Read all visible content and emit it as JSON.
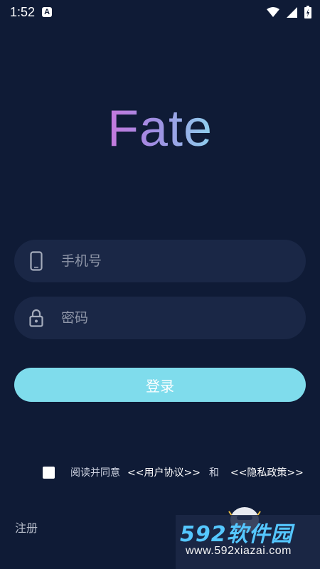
{
  "status_bar": {
    "time": "1:52",
    "notification_badge": "A",
    "icons": [
      "wifi-icon",
      "signal-icon",
      "battery-icon"
    ]
  },
  "app": {
    "logo_text": "Fate"
  },
  "login_form": {
    "phone_placeholder": "手机号",
    "password_placeholder": "密码",
    "login_label": "登录"
  },
  "agreement": {
    "prefix": "阅读并同意",
    "user_agreement": "<<用户协议>>",
    "and": "和",
    "privacy_policy": "<<隐私政策>>",
    "checked": false
  },
  "footer": {
    "register_label": "注册"
  },
  "watermark": {
    "brand": "592软件园",
    "url": "www.592xiazai.com"
  },
  "colors": {
    "background": "#0f1b36",
    "input_background": "#1a2746",
    "button": "#7fdcec",
    "logo_gradient_start": "#c678dd",
    "logo_gradient_end": "#8fd1ee",
    "watermark_text": "#55c7ff"
  }
}
